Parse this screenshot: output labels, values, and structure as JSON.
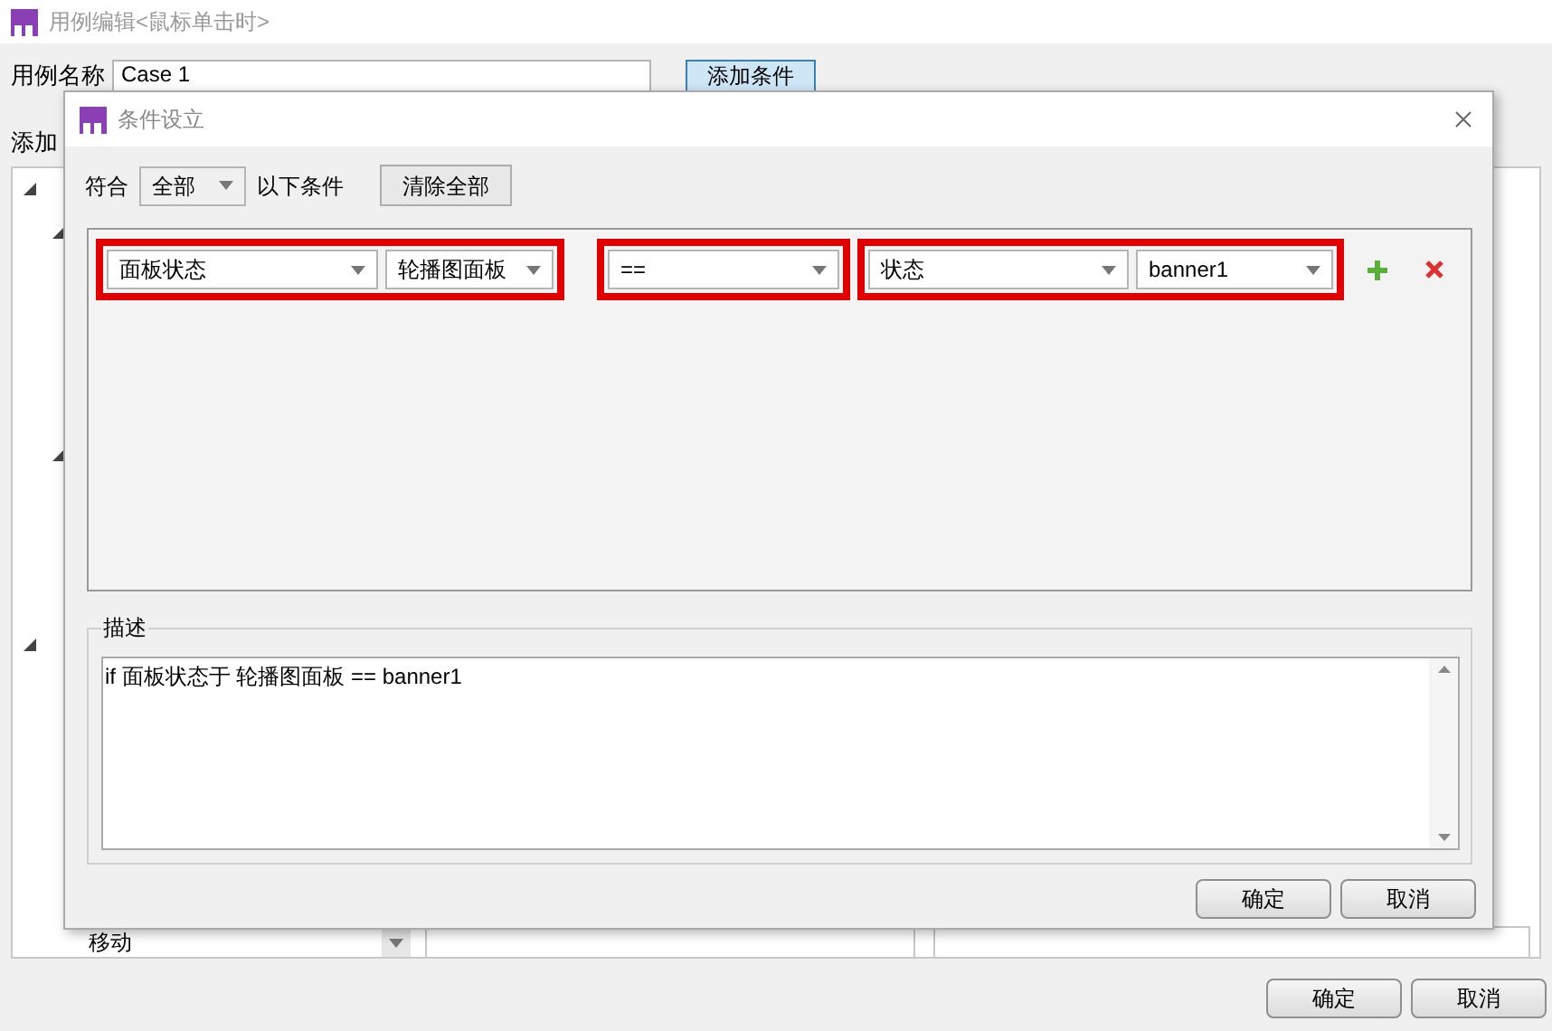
{
  "window": {
    "title": "用例编辑<鼠标单击时>"
  },
  "case_name": {
    "label": "用例名称",
    "value": "Case 1"
  },
  "add_condition_button": "添加条件",
  "add_action_label": "添加",
  "action_select": {
    "value": "移动"
  },
  "buttons": [
    "确定",
    "取消"
  ],
  "dialog": {
    "title": "条件设立",
    "match_label": "符合",
    "match_select": {
      "value": "全部"
    },
    "match_suffix": "以下条件",
    "clear_button": "清除全部",
    "condition_groups": [
      {
        "highlighted": true,
        "fields": [
          {
            "value": "面板状态"
          },
          {
            "value": "轮播图面板"
          }
        ]
      },
      {
        "highlighted": true,
        "fields": [
          {
            "value": "=="
          }
        ]
      },
      {
        "highlighted": true,
        "fields": [
          {
            "value": "状态"
          },
          {
            "value": "banner1"
          }
        ]
      }
    ],
    "description": {
      "legend": "描述",
      "value": "if 面板状态于 轮播图面板 == banner1"
    },
    "buttons": [
      "确定",
      "取消"
    ]
  }
}
